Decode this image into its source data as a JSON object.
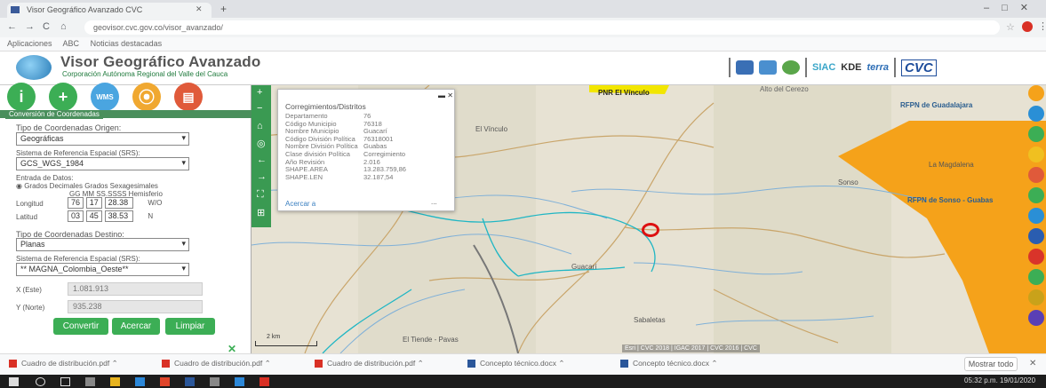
{
  "browser": {
    "tab_title": "Visor Geográfico Avanzado CVC",
    "url": "geovisor.cvc.gov.co/visor_avanzado/",
    "bookmarks": [
      "Aplicaciones",
      "ABC",
      "Noticias destacadas"
    ]
  },
  "header": {
    "title": "Visor Geográfico Avanzado",
    "subtitle": "Corporación Autónoma Regional del Valle del Cauca",
    "brands": [
      "SIAC",
      "KDE",
      "terra",
      "CVC"
    ]
  },
  "left_panel": {
    "title": "Conversión de Coordenadas",
    "origin_type_label": "Tipo de Coordenadas Origen:",
    "origin_type_value": "Geográficas",
    "origin_srs_label": "Sistema de Referencia Espacial (SRS):",
    "origin_srs_value": "GCS_WGS_1984",
    "data_input_label": "Entrada de Datos:",
    "data_input_options": "Grados Decimales  Grados Sexagesimales",
    "dms_header": "GG  MM  SS.SSSS  Hemisferio",
    "lon_label": "Longitud",
    "lon_values": [
      "76",
      "17",
      "28.38",
      "W/O"
    ],
    "lat_label": "Latitud",
    "lat_values": [
      "03",
      "45",
      "38.53",
      "N"
    ],
    "dest_type_label": "Tipo de Coordenadas Destino:",
    "dest_type_value": "Planas",
    "dest_srs_label": "Sistema de Referencia Espacial (SRS):",
    "dest_srs_value": "** MAGNA_Colombia_Oeste**",
    "x_label": "X (Este)",
    "x_value": "1.081.913",
    "y_label": "Y (Norte)",
    "y_value": "935.238",
    "buttons": {
      "convert": "Convertir",
      "zoom": "Acercar",
      "clear": "Limpiar"
    }
  },
  "info_panel": {
    "title": "Corregimientos/Distritos",
    "rows": [
      {
        "k": "Departamento",
        "v": "76"
      },
      {
        "k": "Código Municipio",
        "v": "76318"
      },
      {
        "k": "Nombre Municipio",
        "v": "Guacarí"
      },
      {
        "k": "Código División Política",
        "v": "76318001"
      },
      {
        "k": "Nombre División Política",
        "v": "Guabas"
      },
      {
        "k": "Clase división Política",
        "v": "Corregimiento"
      },
      {
        "k": "Año Revisión",
        "v": "2.016"
      },
      {
        "k": "SHAPE.AREA",
        "v": "13.283.759,86"
      },
      {
        "k": "SHAPE.LEN",
        "v": "32.187,54"
      }
    ],
    "zoom_link": "Acercar a",
    "more": "..."
  },
  "map": {
    "labels": {
      "pnr": "PNR El Vínculo",
      "rffn_guada": "RFPN de Guadalajara",
      "rffn_sonso": "RFPN de Sonso - Guabas",
      "vinculo": "El Vínculo",
      "guacari": "Guacarí",
      "sabaletas": "Sabaletas",
      "tiende": "El Tiende - Pavas",
      "la_magdalena": "La Magdalena",
      "sonso": "Sonso",
      "alto_cerezo": "Alto del Cerezo"
    },
    "attribution": "Esri | CVC 2018 | IGAC 2017 | CVC 2016 | CVC",
    "scale": "2 km"
  },
  "downloads": [
    "Cuadro de distribución.pdf",
    "Cuadro de distribución.pdf",
    "Cuadro de distribución.pdf",
    "Concepto técnico.docx",
    "Concepto técnico.docx"
  ],
  "downloads_show_all": "Mostrar todo",
  "tray": "05:32 p.m. 19/01/2020",
  "colors": {
    "accent": "#3cae55",
    "map_orange": "#f5a21a",
    "reserve_yellow": "#f2e600"
  }
}
